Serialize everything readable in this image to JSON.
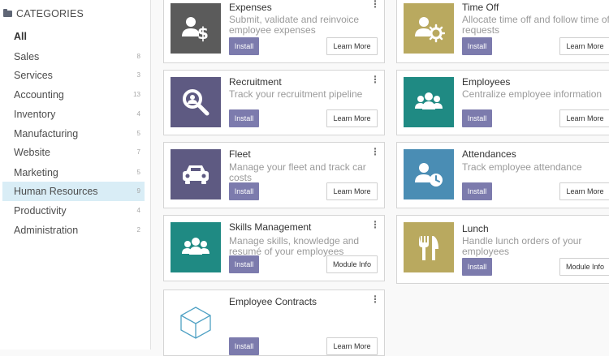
{
  "sidebar": {
    "header": "CATEGORIES",
    "items": [
      {
        "label": "All",
        "count": ""
      },
      {
        "label": "Sales",
        "count": "8"
      },
      {
        "label": "Services",
        "count": "3"
      },
      {
        "label": "Accounting",
        "count": "13"
      },
      {
        "label": "Inventory",
        "count": "4"
      },
      {
        "label": "Manufacturing",
        "count": "5"
      },
      {
        "label": "Website",
        "count": "7"
      },
      {
        "label": "Marketing",
        "count": "5"
      },
      {
        "label": "Human Resources",
        "count": "9"
      },
      {
        "label": "Productivity",
        "count": "4"
      },
      {
        "label": "Administration",
        "count": "2"
      }
    ]
  },
  "apps": {
    "expenses": {
      "title": "Expenses",
      "desc": "Submit, validate and reinvoice employee expenses",
      "install": "Install",
      "secondary": "Learn More",
      "icon": "expenses-icon",
      "color": "#5b5b5b"
    },
    "timeoff": {
      "title": "Time Off",
      "desc": "Allocate time off and follow time off requests",
      "install": "Install",
      "secondary": "Learn More",
      "icon": "time-off-icon",
      "color": "#b9a95f"
    },
    "recruitment": {
      "title": "Recruitment",
      "desc": "Track your recruitment pipeline",
      "install": "Install",
      "secondary": "Learn More",
      "icon": "magnifier-icon",
      "color": "#5e5a82"
    },
    "employees": {
      "title": "Employees",
      "desc": "Centralize employee information",
      "install": "Install",
      "secondary": "Learn More",
      "icon": "people-group-icon",
      "color": "#1f8a83"
    },
    "fleet": {
      "title": "Fleet",
      "desc": "Manage your fleet and track car costs",
      "install": "Install",
      "secondary": "Learn More",
      "icon": "car-icon",
      "color": "#5e5a82"
    },
    "attendances": {
      "title": "Attendances",
      "desc": "Track employee attendance",
      "install": "Install",
      "secondary": "Learn More",
      "icon": "user-clock-icon",
      "color": "#4a8db4"
    },
    "skills": {
      "title": "Skills Management",
      "desc": "Manage skills, knowledge and resumé of your employees",
      "install": "Install",
      "secondary": "Module Info",
      "icon": "people-group-icon",
      "color": "#1f8a83"
    },
    "lunch": {
      "title": "Lunch",
      "desc": "Handle lunch orders of your employees",
      "install": "Install",
      "secondary": "Module Info",
      "icon": "fork-knife-icon",
      "color": "#b9a95f"
    },
    "contracts": {
      "title": "Employee Contracts",
      "desc": "",
      "install": "Install",
      "secondary": "Learn More",
      "icon": "cube-icon",
      "color": "#4fa1c4"
    }
  },
  "menu_glyph": "⋮"
}
